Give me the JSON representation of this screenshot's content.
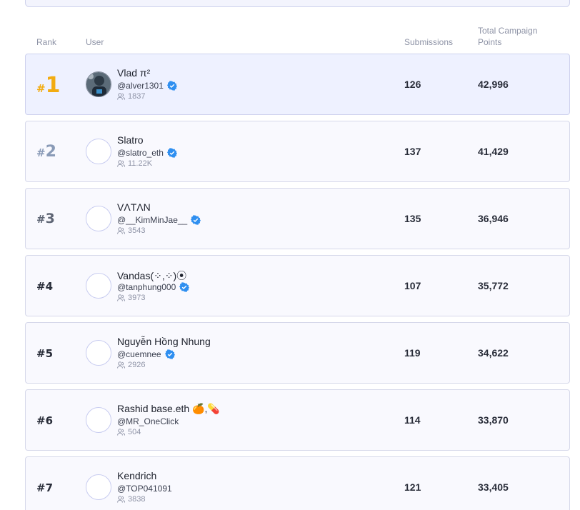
{
  "header": {
    "rank": "Rank",
    "user": "User",
    "submissions": "Submissions",
    "points": "Total Campaign Points"
  },
  "rows": [
    {
      "hash": "#",
      "rank": "1",
      "name": "Vlad π²",
      "handle": "@alver1301",
      "verified": true,
      "followers": "1837",
      "submissions": "126",
      "points": "42,996"
    },
    {
      "hash": "#",
      "rank": "2",
      "name": "Slatro",
      "handle": "@slatro_eth",
      "verified": true,
      "followers": "11.22K",
      "submissions": "137",
      "points": "41,429"
    },
    {
      "hash": "#",
      "rank": "3",
      "name": "VΛTΛN",
      "handle": "@__KimMinJae__",
      "verified": true,
      "followers": "3543",
      "submissions": "135",
      "points": "36,946"
    },
    {
      "hash": "#",
      "rank": "4",
      "name": "Vandas(⁘,⁘)⦿",
      "handle": "@tanphung000",
      "verified": true,
      "followers": "3973",
      "submissions": "107",
      "points": "35,772"
    },
    {
      "hash": "#",
      "rank": "5",
      "name": "Nguyễn Hồng Nhung",
      "handle": "@cuemnee",
      "verified": true,
      "followers": "2926",
      "submissions": "119",
      "points": "34,622"
    },
    {
      "hash": "#",
      "rank": "6",
      "name": "Rashid base.eth 🍊,💊",
      "handle": "@MR_OneClick",
      "verified": false,
      "followers": "504",
      "submissions": "114",
      "points": "33,870"
    },
    {
      "hash": "#",
      "rank": "7",
      "name": "Kendrich",
      "handle": "@TOP041091",
      "verified": false,
      "followers": "3838",
      "submissions": "121",
      "points": "33,405"
    }
  ],
  "icons": {
    "verified": "verified-badge-icon",
    "followers": "users-icon"
  },
  "colors": {
    "gold": "#f2ac12",
    "silver": "#8a9bb7",
    "bronze": "#5f6675",
    "verified": "#2f8ff0"
  }
}
